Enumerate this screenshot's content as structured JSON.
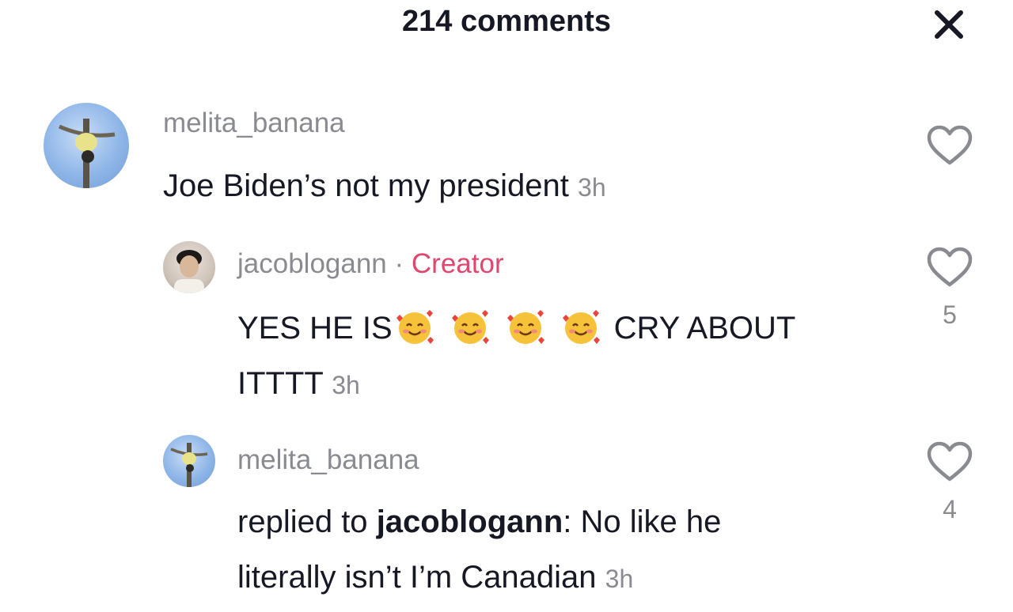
{
  "header": {
    "title": "214 comments",
    "close_icon": "close-icon"
  },
  "comments": [
    {
      "username": "melita_banana",
      "text": "Joe Biden’s not my president",
      "time": "3h",
      "like_count": ""
    },
    {
      "username": "jacoblogann",
      "separator": "·",
      "badge": "Creator",
      "text_line1": "YES HE IS",
      "text_after_emoji": "CRY ABOUT",
      "text_line2": "ITTTT",
      "emoji": "smiling-face-with-hearts",
      "time": "3h",
      "like_count": "5"
    },
    {
      "username": "melita_banana",
      "reply_prefix": "replied to",
      "reply_to": "jacoblogann",
      "text_line1": ": No like he",
      "text_line2": "literally isn’t I’m Canadian",
      "time": "3h",
      "like_count": "4"
    }
  ],
  "colors": {
    "creator_badge": "#e0476f",
    "muted_text": "#8a8b91",
    "primary_text": "#161823"
  }
}
